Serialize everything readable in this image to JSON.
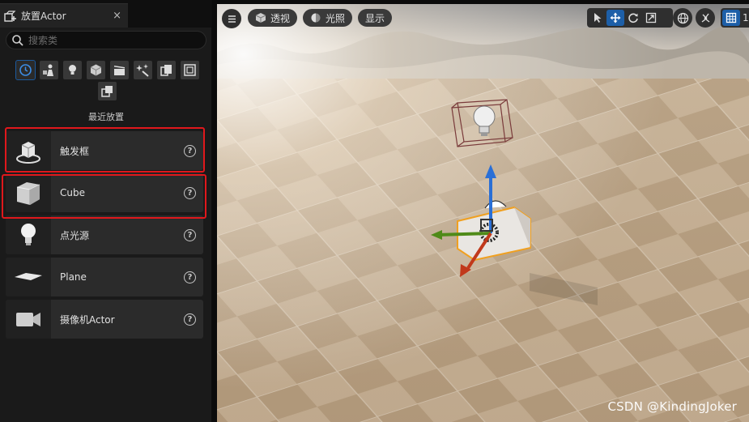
{
  "panel": {
    "tab_title": "放置Actor",
    "close_glyph": "×",
    "search_placeholder": "搜索类",
    "section_title": "最近放置",
    "categories": [
      "recent-icon",
      "basic-icon",
      "lights-icon",
      "shapes-icon",
      "cinematic-icon",
      "visual-effects-icon",
      "volumes-icon",
      "all-classes-icon",
      "misc-icon"
    ],
    "items": [
      {
        "label": "触发框",
        "icon": "trigger-box-icon"
      },
      {
        "label": "Cube",
        "icon": "cube-icon"
      },
      {
        "label": "点光源",
        "icon": "point-light-icon"
      },
      {
        "label": "Plane",
        "icon": "plane-icon"
      },
      {
        "label": "摄像机Actor",
        "icon": "camera-icon"
      }
    ],
    "help_glyph": "?"
  },
  "viewport": {
    "menu_icon": "hamburger-icon",
    "perspective_label": "透视",
    "lighting_label": "光照",
    "show_label": "显示",
    "transform_tools": [
      "select-icon",
      "translate-icon",
      "rotate-icon",
      "scale-icon"
    ],
    "grid_snap_value": "1"
  },
  "highlight_color": "#e0181c",
  "accent_color": "#1d5fa8",
  "watermark": "CSDN @KindingJoker"
}
